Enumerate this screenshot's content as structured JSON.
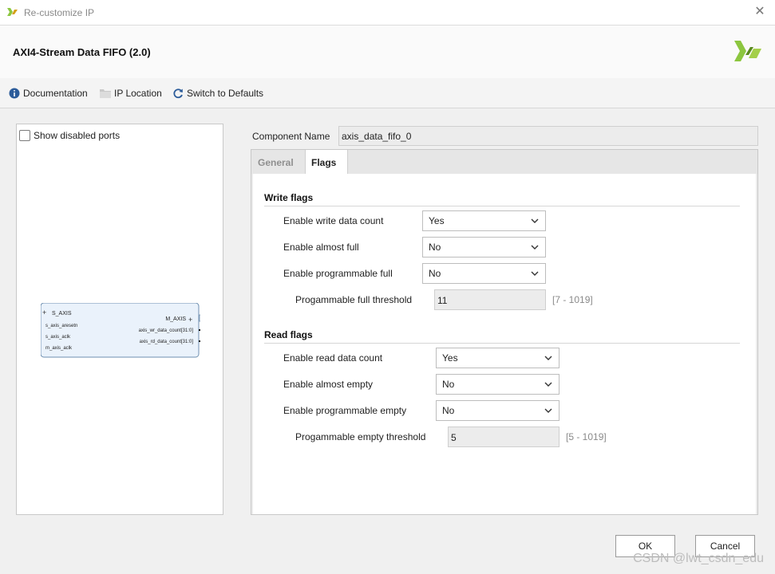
{
  "window": {
    "title": "Re-customize IP"
  },
  "header": {
    "ip_title": "AXI4-Stream Data FIFO (2.0)"
  },
  "toolbar": {
    "documentation": "Documentation",
    "ip_location": "IP Location",
    "switch_defaults": "Switch to Defaults"
  },
  "left": {
    "show_disabled": "Show disabled ports",
    "block": {
      "s_axis": "S_AXIS",
      "m_axis": "M_AXIS",
      "left_ports": [
        "s_axis_aresetn",
        "s_axis_aclk",
        "m_axis_aclk"
      ],
      "right_ports": [
        "axis_wr_data_count[31:0]",
        "axis_rd_data_count[31:0]"
      ]
    }
  },
  "component": {
    "label": "Component Name",
    "value": "axis_data_fifo_0"
  },
  "tabs": [
    {
      "label": "General"
    },
    {
      "label": "Flags"
    }
  ],
  "write_flags": {
    "title": "Write flags",
    "rows": [
      {
        "label": "Enable write data count",
        "value": "Yes"
      },
      {
        "label": "Enable almost full",
        "value": "No"
      },
      {
        "label": "Enable programmable full",
        "value": "No"
      }
    ],
    "threshold": {
      "label": "Progammable full threshold",
      "value": "11",
      "range": "[7 - 1019]"
    }
  },
  "read_flags": {
    "title": "Read flags",
    "rows": [
      {
        "label": "Enable read data count",
        "value": "Yes"
      },
      {
        "label": "Enable almost empty",
        "value": "No"
      },
      {
        "label": "Enable programmable empty",
        "value": "No"
      }
    ],
    "threshold": {
      "label": "Progammable empty threshold",
      "value": "5",
      "range": "[5 - 1019]"
    }
  },
  "buttons": {
    "ok": "OK",
    "cancel": "Cancel"
  },
  "watermark": "CSDN @lwt_csdn_edu",
  "colors": {
    "accent": "#8cc63f",
    "accent_dark": "#5a8a1e",
    "block_fill": "#eaf2fb",
    "block_border": "#6f8fb0"
  }
}
